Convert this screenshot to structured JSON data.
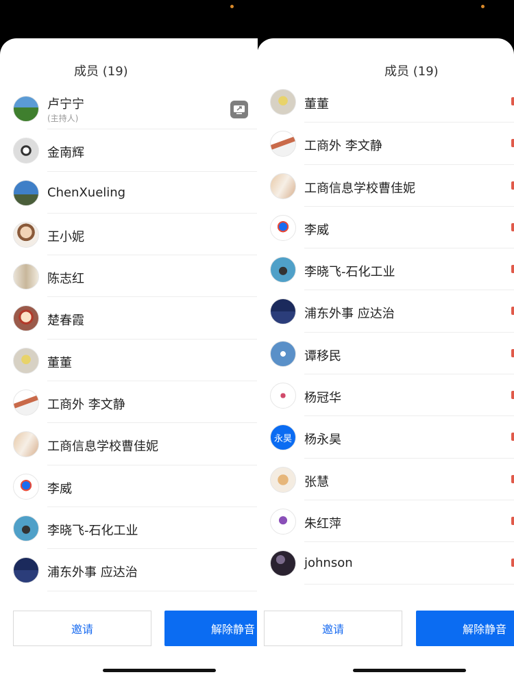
{
  "left": {
    "title": "成员 (19)",
    "host_note": "(主持人)",
    "members": [
      {
        "name": "卢宁宁",
        "avatar": "av-a",
        "host": true
      },
      {
        "name": "金南辉",
        "avatar": "av-b"
      },
      {
        "name": "ChenXueling",
        "avatar": "av-c"
      },
      {
        "name": "王小妮",
        "avatar": "av-d"
      },
      {
        "name": "陈志红",
        "avatar": "av-e"
      },
      {
        "name": "楚春霞",
        "avatar": "av-f"
      },
      {
        "name": "董董",
        "avatar": "av-g"
      },
      {
        "name": "工商外 李文静",
        "avatar": "av-h"
      },
      {
        "name": "工商信息学校曹佳妮",
        "avatar": "av-i"
      },
      {
        "name": "李威",
        "avatar": "av-j"
      },
      {
        "name": "李晓飞-石化工业",
        "avatar": "av-k"
      },
      {
        "name": "浦东外事 应达治",
        "avatar": "av-l"
      }
    ],
    "invite_label": "邀请",
    "unmute_label": "解除静音"
  },
  "right": {
    "title": "成员 (19)",
    "members": [
      {
        "name": "董董",
        "avatar": "av-g"
      },
      {
        "name": "工商外 李文静",
        "avatar": "av-h"
      },
      {
        "name": "工商信息学校曹佳妮",
        "avatar": "av-i"
      },
      {
        "name": "李威",
        "avatar": "av-j"
      },
      {
        "name": "李晓飞-石化工业",
        "avatar": "av-k"
      },
      {
        "name": "浦东外事 应达治",
        "avatar": "av-l"
      },
      {
        "name": "谭移民",
        "avatar": "av-m"
      },
      {
        "name": "杨冠华",
        "avatar": "av-n"
      },
      {
        "name": "杨永昊",
        "avatar": "av-o",
        "initials": "永昊"
      },
      {
        "name": "张慧",
        "avatar": "av-p"
      },
      {
        "name": "朱红萍",
        "avatar": "av-q"
      },
      {
        "name": "johnson",
        "avatar": "av-r"
      }
    ],
    "invite_label": "邀请",
    "unmute_label": "解除静音"
  },
  "icons": [
    "share-screen-icon"
  ],
  "colors": {
    "accent": "#0b6cf2",
    "text": "#222222",
    "muted": "#999999"
  }
}
